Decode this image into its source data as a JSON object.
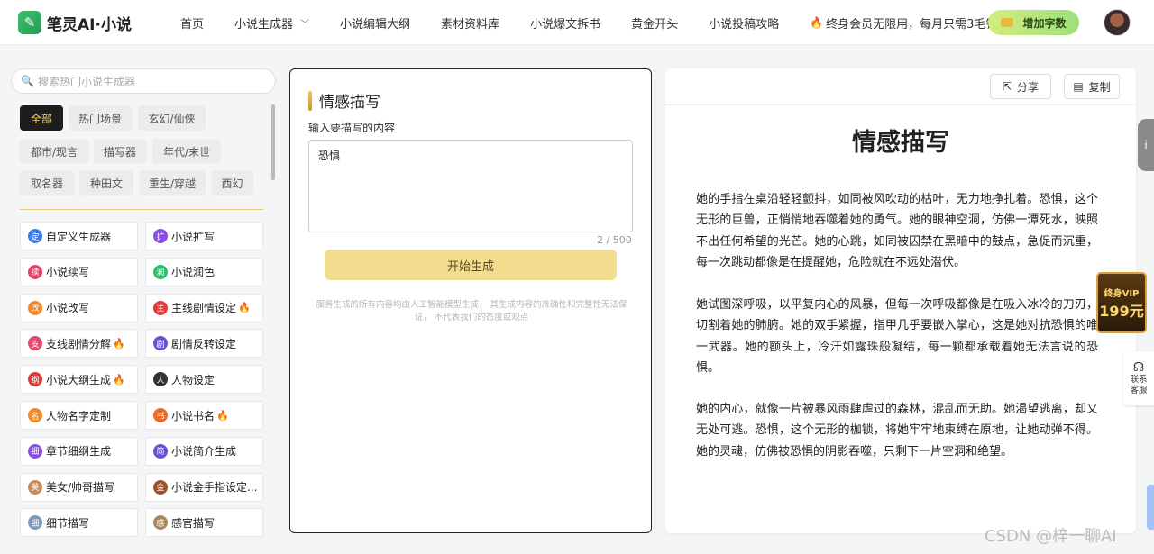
{
  "header": {
    "brand": "笔灵AI·小说",
    "nav": [
      "首页",
      "小说生成器",
      "小说编辑大纲",
      "素材资料库",
      "小说爆文拆书",
      "黄金开头",
      "小说投稿攻略"
    ],
    "promo": "终身会员无限用，每月只需3毛钱",
    "add_words": "增加字数"
  },
  "sidebar": {
    "search_placeholder": "搜索热门小说生成器",
    "categories": [
      "全部",
      "热门场景",
      "玄幻/仙侠",
      "都市/现言",
      "描写器",
      "年代/末世",
      "取名器",
      "种田文",
      "重生/穿越",
      "西幻"
    ],
    "tools": [
      {
        "label": "自定义生成器",
        "icon": "定",
        "color": "#3d7cf0",
        "hot": false
      },
      {
        "label": "小说扩写",
        "icon": "扩",
        "color": "#8a4fe0",
        "hot": false
      },
      {
        "label": "小说续写",
        "icon": "续",
        "color": "#e8456d",
        "hot": false
      },
      {
        "label": "小说润色",
        "icon": "润",
        "color": "#2fbf6a",
        "hot": false
      },
      {
        "label": "小说改写",
        "icon": "改",
        "color": "#f08a2a",
        "hot": false
      },
      {
        "label": "主线剧情设定",
        "icon": "主",
        "color": "#e23b3b",
        "hot": true
      },
      {
        "label": "支线剧情分解",
        "icon": "支",
        "color": "#e8456d",
        "hot": true
      },
      {
        "label": "剧情反转设定",
        "icon": "剧",
        "color": "#6a4fd8",
        "hot": false
      },
      {
        "label": "小说大纲生成",
        "icon": "纲",
        "color": "#e23b3b",
        "hot": true
      },
      {
        "label": "人物设定",
        "icon": "人",
        "color": "#333333",
        "hot": false
      },
      {
        "label": "人物名字定制",
        "icon": "名",
        "color": "#f08a2a",
        "hot": false
      },
      {
        "label": "小说书名",
        "icon": "书",
        "color": "#f06a2a",
        "hot": true
      },
      {
        "label": "章节细纲生成",
        "icon": "细",
        "color": "#8a4fe0",
        "hot": false
      },
      {
        "label": "小说简介生成",
        "icon": "简",
        "color": "#6a4fd8",
        "hot": false
      },
      {
        "label": "美女/帅哥描写",
        "icon": "美",
        "color": "#c78a5a",
        "hot": false
      },
      {
        "label": "小说金手指设定...",
        "icon": "金",
        "color": "#a0522d",
        "hot": false
      },
      {
        "label": "细节描写",
        "icon": "细",
        "color": "#7a9ab8",
        "hot": false
      },
      {
        "label": "感官描写",
        "icon": "感",
        "color": "#a88a5a",
        "hot": false
      }
    ]
  },
  "editor": {
    "title": "情感描写",
    "input_label": "输入要描写的内容",
    "input_value": "恐惧",
    "counter": "2 / 500",
    "generate": "开始生成",
    "disclaimer": "服务生成的所有内容均由人工智能模型生成， 其生成内容的准确性和完整性无法保证， 不代表我们的态度或观点"
  },
  "output": {
    "share": "分享",
    "copy": "复制",
    "title": "情感描写",
    "paragraphs": [
      "她的手指在桌沿轻轻颤抖，如同被风吹动的枯叶，无力地挣扎着。恐惧，这个无形的巨兽，正悄悄地吞噬着她的勇气。她的眼神空洞，仿佛一潭死水，映照不出任何希望的光芒。她的心跳，如同被囚禁在黑暗中的鼓点，急促而沉重，每一次跳动都像是在提醒她，危险就在不远处潜伏。",
      "她试图深呼吸，以平复内心的风暴，但每一次呼吸都像是在吸入冰冷的刀刃，切割着她的肺腑。她的双手紧握，指甲几乎要嵌入掌心，这是她对抗恐惧的唯一武器。她的额头上，冷汗如露珠般凝结，每一颗都承载着她无法言说的恐惧。",
      "她的内心，就像一片被暴风雨肆虐过的森林，混乱而无助。她渴望逃离，却又无处可逃。恐惧，这个无形的枷锁，将她牢牢地束缚在原地，让她动弹不得。她的灵魂，仿佛被恐惧的阴影吞噬，只剩下一片空洞和绝望。"
    ]
  },
  "floating": {
    "vip_line1": "终身VIP",
    "vip_line2": "199元",
    "service": "联系客服",
    "watermark": "CSDN @梓一聊AI"
  }
}
